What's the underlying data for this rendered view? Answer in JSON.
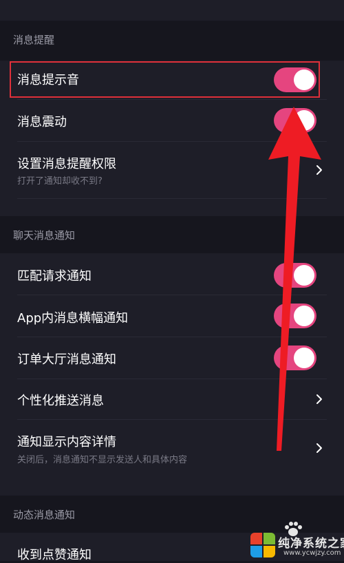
{
  "sections": [
    {
      "title": "消息提醒",
      "rows": [
        {
          "label": "消息提示音",
          "control": "toggle",
          "on": true
        },
        {
          "label": "消息震动",
          "control": "toggle",
          "on": true
        },
        {
          "label": "设置消息提醒权限",
          "sublabel": "打开了通知却收不到?",
          "control": "chevron"
        }
      ]
    },
    {
      "title": "聊天消息通知",
      "rows": [
        {
          "label": "匹配请求通知",
          "control": "toggle",
          "on": true
        },
        {
          "label": "App内消息横幅通知",
          "control": "toggle",
          "on": true
        },
        {
          "label": "订单大厅消息通知",
          "control": "toggle",
          "on": true
        },
        {
          "label": "个性化推送消息",
          "control": "chevron"
        },
        {
          "label": "通知显示内容详情",
          "sublabel": "关闭后，消息通知不显示发送人和具体内容",
          "control": "chevron"
        }
      ]
    },
    {
      "title": "动态消息通知",
      "rows": [
        {
          "label": "收到点赞通知",
          "control": "toggle",
          "on": true
        }
      ]
    }
  ],
  "watermark": {
    "title": "纯净系统之家",
    "url": "www.ycwjzy.com"
  },
  "colors": {
    "background": "#16161e",
    "group_background": "#1e1e28",
    "toggle_on": "#e5457f",
    "annotation": "#e0303a"
  },
  "icons": [
    "chevron-right-icon",
    "toggle-switch",
    "annotation-arrow",
    "paw-icon",
    "windows-logo-icon"
  ]
}
